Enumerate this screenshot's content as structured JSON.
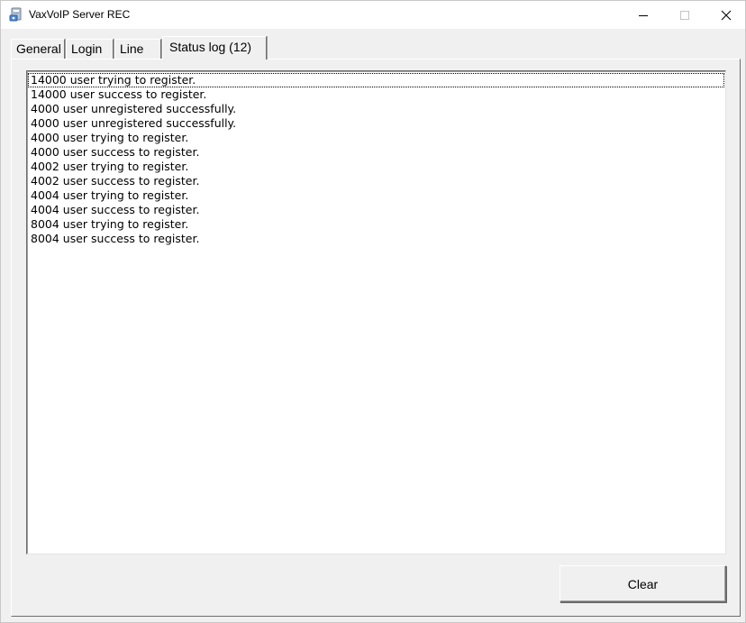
{
  "window": {
    "title": "VaxVoIP Server REC",
    "icon": "app-icon"
  },
  "tabs": [
    {
      "label": "General",
      "active": false
    },
    {
      "label": "Login",
      "active": false
    },
    {
      "label": "Line",
      "active": false
    },
    {
      "label": "Status log (12)",
      "active": true
    }
  ],
  "status_log": {
    "items": [
      "14000 user trying to register.",
      "14000 user success to register.",
      "4000 user unregistered successfully.",
      "4000 user unregistered successfully.",
      "4000 user trying to register.",
      "4000 user success to register.",
      "4002 user trying to register.",
      "4002 user success to register.",
      "4004 user trying to register.",
      "4004 user success to register.",
      "8004 user trying to register.",
      "8004 user success to register."
    ]
  },
  "buttons": {
    "clear_label": "Clear"
  }
}
